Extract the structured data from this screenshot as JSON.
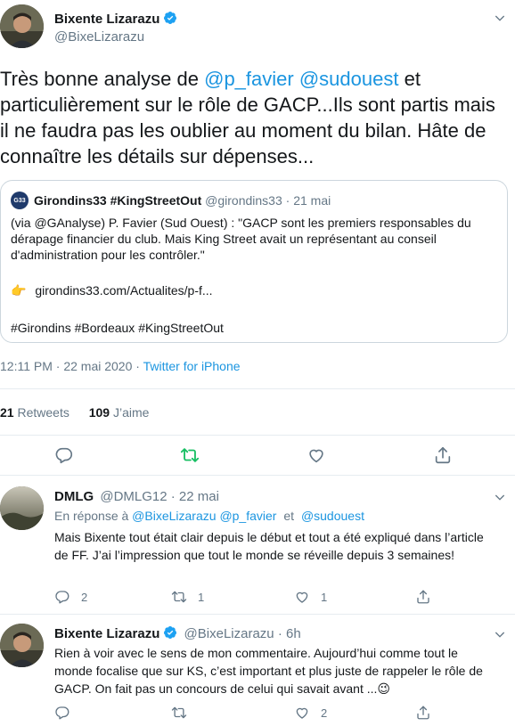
{
  "main_tweet": {
    "author_name": "Bixente Lizarazu",
    "author_handle": "@BixeLizarazu",
    "text_parts": [
      "Très bonne analyse de ",
      "@p_favier",
      " ",
      "@sudouest",
      " et particulièrement sur le rôle de GACP...Ils sont partis mais il ne faudra pas les oublier au moment du bilan. Hâte de connaître les détails sur dépenses..."
    ],
    "timestamp": "12:11 PM · 22 mai 2020",
    "separator": " · ",
    "client": "Twitter for iPhone",
    "retweets_count": "21",
    "retweets_label": "Retweets",
    "likes_count": "109",
    "likes_label": "J’aime"
  },
  "quoted_tweet": {
    "author_name": "Girondins33 #KingStreetOut",
    "author_handle": "@girondins33",
    "date": "· 21 mai",
    "avatar_text": "G33",
    "line1": "(via @GAnalyse) P. Favier (Sud Ouest) : \"GACP sont les premiers responsables du dérapage financier du club. Mais King Street avait un représentant au conseil d'administration pour les contrôler.\"",
    "pointing_emoji": "👉",
    "link": "girondins33.com/Actualites/p-f...",
    "hashtags": "#Girondins #Bordeaux #KingStreetOut"
  },
  "replies": [
    {
      "author_name": "DMLG",
      "author_handle": "@DMLG12",
      "date": "· 22 mai",
      "reply_to_prefix": "En réponse à ",
      "reply_to_1": "@BixeLizarazu",
      "reply_to_2": "@p_favier",
      "reply_to_and": "et",
      "reply_to_3": "@sudouest",
      "text": "Mais Bixente tout était clair depuis le début et tout a été expliqué dans l’article de FF. J’ai l’impression que tout le monde se réveille depuis 3 semaines!",
      "reply_count": "2",
      "retweet_count": "1",
      "like_count": "1"
    },
    {
      "author_name": "Bixente Lizarazu",
      "author_handle": "@BixeLizarazu",
      "date": "· 6h",
      "text": "Rien à voir avec  le sens de mon commentaire. Aujourd’hui comme tout le monde focalise que sur KS, c’est important et plus juste de rappeler le rôle de GACP. On fait pas un concours de celui qui savait avant ...",
      "emoji": "😉",
      "reply_count": "",
      "retweet_count": "",
      "like_count": "2"
    }
  ],
  "colors": {
    "link_blue": "#1b95e0",
    "retweet_green": "#17bf63",
    "verified_blue": "#1da1f2",
    "muted_gray": "#657786"
  },
  "icons": [
    "verified-badge-icon",
    "chevron-down-icon",
    "reply-icon",
    "retweet-icon",
    "like-icon",
    "share-icon"
  ]
}
